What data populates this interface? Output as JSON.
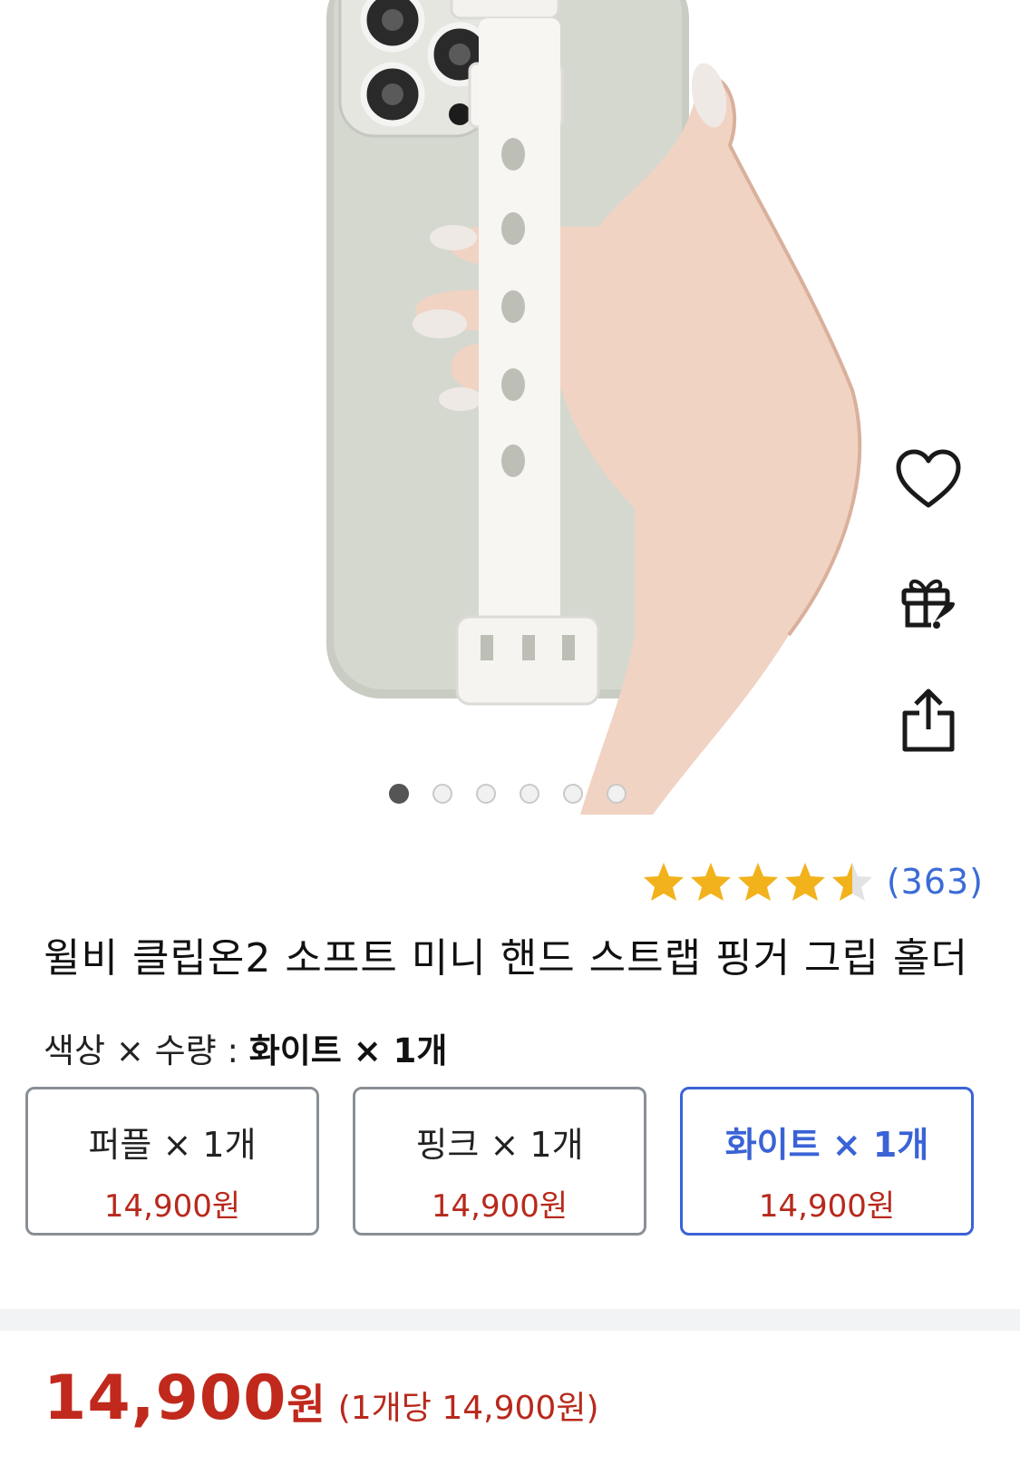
{
  "hero": {
    "image_alt": "phone with white finger strap held in hand",
    "actions": [
      {
        "name": "heart-icon"
      },
      {
        "name": "gift-icon"
      },
      {
        "name": "share-icon"
      }
    ],
    "carousel": {
      "count": 6,
      "active": 1
    }
  },
  "product": {
    "rating": 4.5,
    "review_count": "(363)",
    "title": "윌비 클립온2 소프트 미니 핸드 스트랩 핑거 그립 홀더"
  },
  "option_summary": {
    "label": "색상 × 수량 : ",
    "selected": "화이트 × 1개"
  },
  "options": [
    {
      "name": "퍼플 × 1개",
      "price": "14,900원",
      "selected": false
    },
    {
      "name": "핑크 × 1개",
      "price": "14,900원",
      "selected": false
    },
    {
      "name": "화이트 × 1개",
      "price": "14,900원",
      "selected": true
    }
  ],
  "price": {
    "amount": "14,900",
    "currency": "원",
    "unit_price": "(1개당 14,900원)"
  },
  "colors": {
    "accent_blue": "#3a63d6",
    "price_red": "#c0291c",
    "star": "#f2b21c"
  }
}
